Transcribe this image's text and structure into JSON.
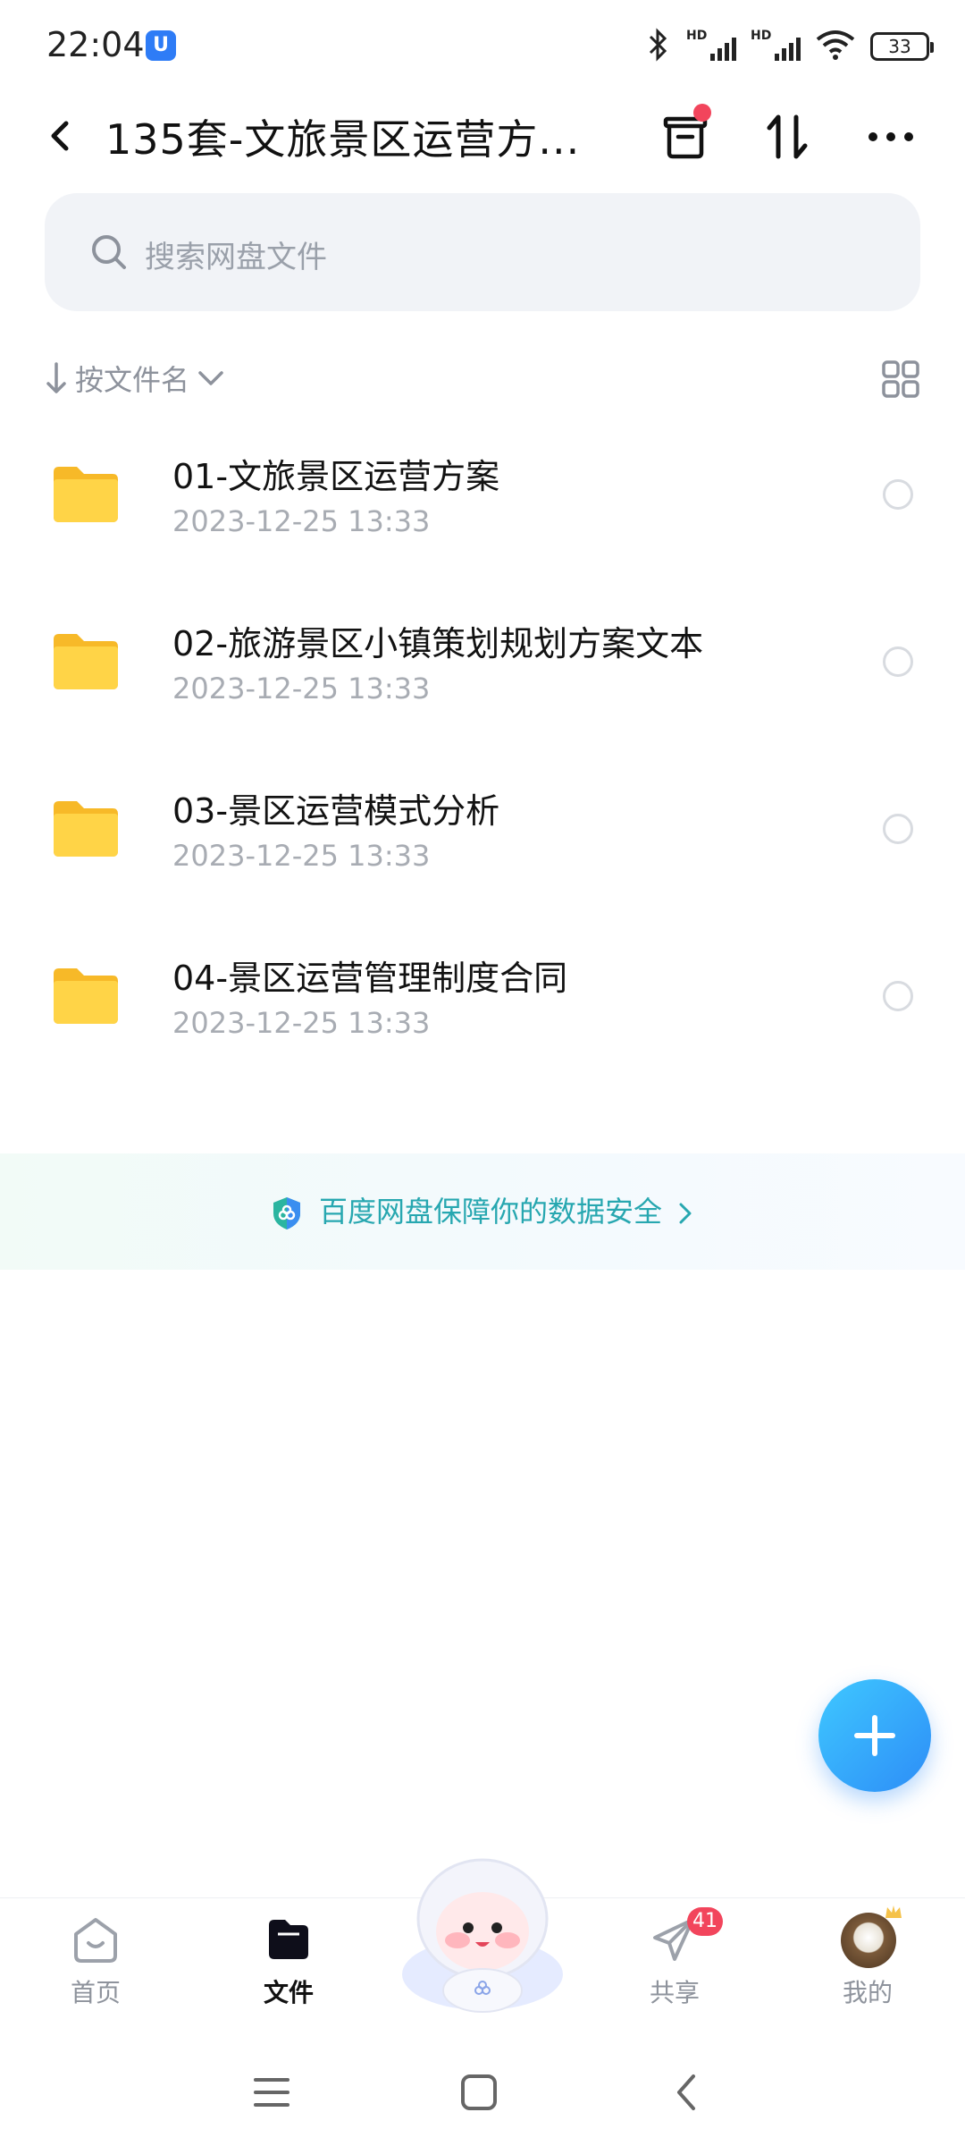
{
  "status_bar": {
    "time": "22:04",
    "app_badge": "U",
    "battery": "33",
    "icons": [
      "bluetooth-icon",
      "signal-hd-icon",
      "signal-hd-icon",
      "wifi-icon",
      "battery-icon"
    ]
  },
  "header": {
    "title": "135套-文旅景区运营方...",
    "icons": [
      "back-icon",
      "transfer-box-icon",
      "sort-arrows-icon",
      "more-icon"
    ]
  },
  "search": {
    "placeholder": "搜索网盘文件"
  },
  "sort": {
    "label": "按文件名"
  },
  "files": [
    {
      "name": "01-文旅景区运营方案",
      "date": "2023-12-25  13:33"
    },
    {
      "name": "02-旅游景区小镇策划规划方案文本",
      "date": "2023-12-25  13:33"
    },
    {
      "name": "03-景区运营模式分析",
      "date": "2023-12-25  13:33"
    },
    {
      "name": "04-景区运营管理制度合同",
      "date": "2023-12-25  13:33"
    }
  ],
  "security_banner": {
    "text": "百度网盘保障你的数据安全"
  },
  "bottom_nav": {
    "items": [
      {
        "label": "首页"
      },
      {
        "label": "文件"
      },
      {
        "label": "共享",
        "badge": "41"
      },
      {
        "label": "我的"
      }
    ]
  },
  "colors": {
    "accent": "#2d8df7",
    "banner_text": "#27a7b0",
    "folder": "#ffcf3a",
    "badge": "#f2455c"
  }
}
